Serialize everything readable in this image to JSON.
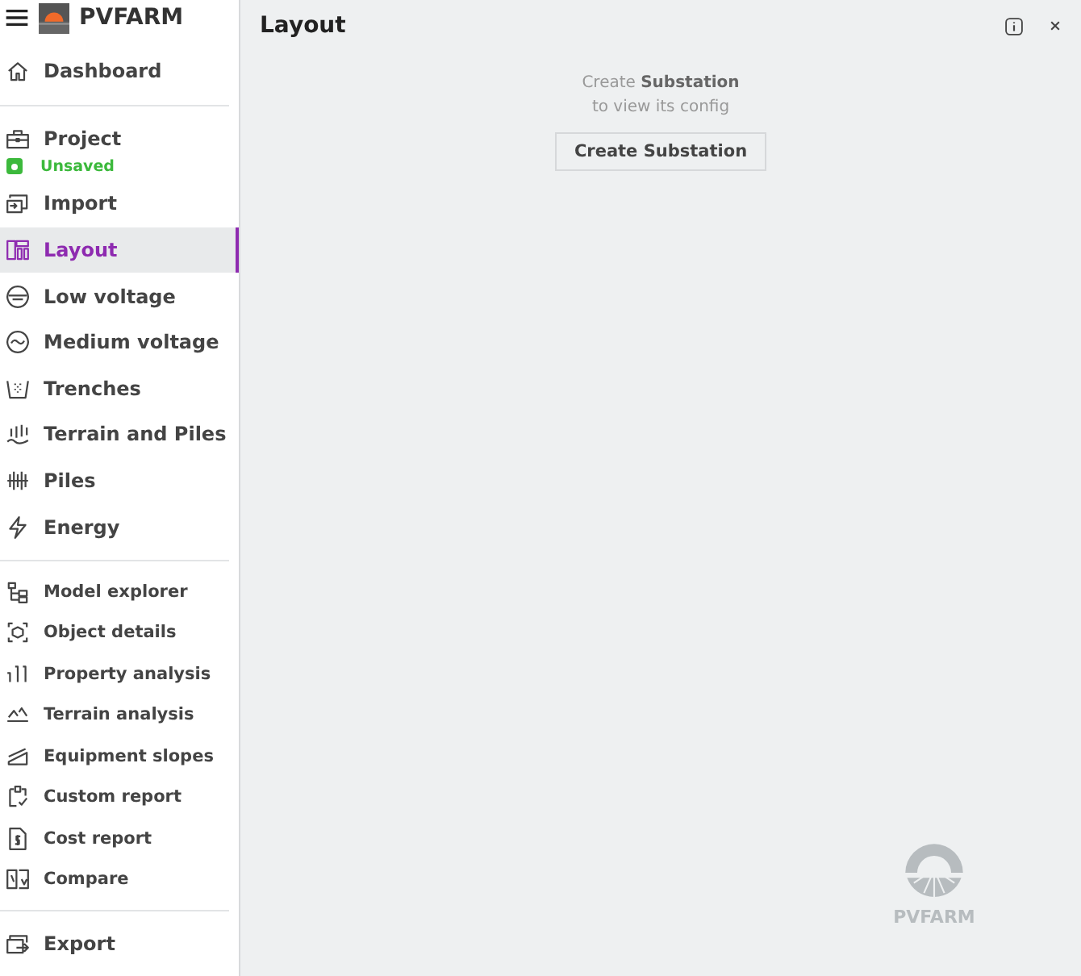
{
  "sidebar": {
    "brand": "PVFARM",
    "groups": [
      {
        "kind": "main",
        "items": [
          {
            "label": "Dashboard",
            "selected": false
          }
        ]
      },
      {
        "kind": "main",
        "items": [
          {
            "label": "Project",
            "selected": false,
            "status": "Unsaved"
          },
          {
            "label": "Import",
            "selected": false
          },
          {
            "label": "Layout",
            "selected": true
          },
          {
            "label": "Low voltage",
            "selected": false
          },
          {
            "label": "Medium voltage",
            "selected": false
          },
          {
            "label": "Trenches",
            "selected": false
          },
          {
            "label": "Terrain and Piles",
            "selected": false
          },
          {
            "label": "Piles",
            "selected": false
          },
          {
            "label": "Energy",
            "selected": false
          }
        ]
      },
      {
        "kind": "small",
        "items": [
          {
            "label": "Model explorer",
            "selected": false
          },
          {
            "label": "Object details",
            "selected": false
          },
          {
            "label": "Property analysis",
            "selected": false
          },
          {
            "label": "Terrain analysis",
            "selected": false
          },
          {
            "label": "Equipment slopes",
            "selected": false
          },
          {
            "label": "Custom report",
            "selected": false
          },
          {
            "label": "Cost report",
            "selected": false
          },
          {
            "label": "Compare",
            "selected": false
          }
        ]
      },
      {
        "kind": "main",
        "items": [
          {
            "label": "Export",
            "selected": false
          }
        ]
      }
    ]
  },
  "panel": {
    "title": "Layout",
    "message": "Create **Substation**",
    "message_line_2": "to view its config",
    "button": "Create Substation",
    "watermark": "PVFARM"
  }
}
